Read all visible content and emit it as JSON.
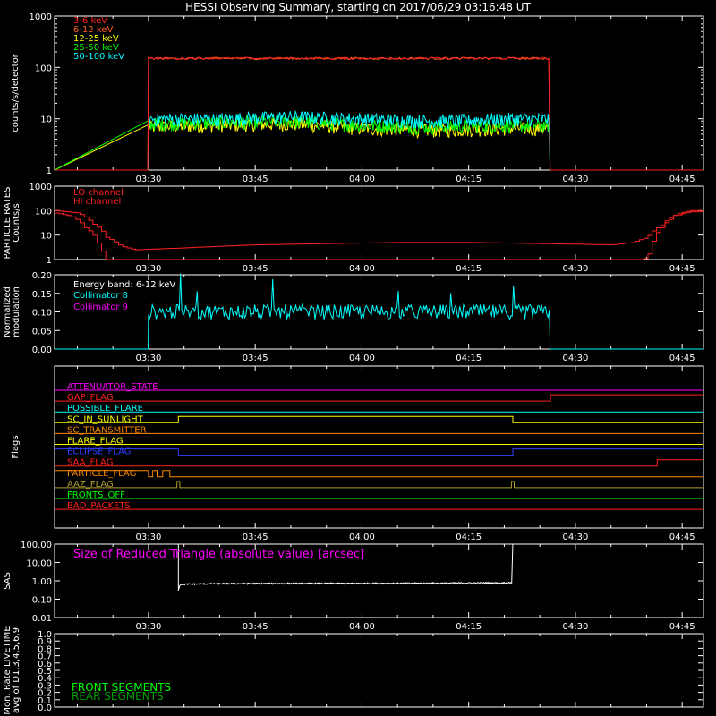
{
  "title": "HESSI Observing Summary, starting on 2017/06/29 03:16:48 UT",
  "time_axis": {
    "start_min": 16.8,
    "end_min": 108,
    "tick_min": [
      30,
      45,
      60,
      75,
      90,
      105
    ],
    "tick_labels": [
      "03:30",
      "03:45",
      "04:00",
      "04:15",
      "04:30",
      "04:45"
    ]
  },
  "colors": {
    "red": "#ff2020",
    "orange": "#ff8800",
    "yellow": "#ffff00",
    "green": "#00ff00",
    "cyan": "#00ffff",
    "magenta": "#ff00ff",
    "blue": "#3040ff",
    "white": "#ffffff",
    "olive": "#b0a030",
    "darkgreen": "#00a000"
  },
  "chart_data": [
    {
      "type": "line",
      "name": "count-rates",
      "ylabel": "counts/s/detector",
      "yscale": "log",
      "ylim": [
        1,
        1000
      ],
      "y_ticks": [
        1,
        10,
        100,
        1000
      ],
      "y_tick_labels": [
        "1",
        "10",
        "100",
        "1000"
      ],
      "legend_position": "top-left",
      "series": [
        {
          "name": "3-6 keV",
          "color": "#ff2020",
          "x": [
            16.8,
            29.9,
            30.0,
            86.4,
            86.5,
            108
          ],
          "y": [
            1,
            1,
            150,
            150,
            1,
            1
          ]
        },
        {
          "name": "6-12 keV",
          "color": "#ff6020",
          "x": [
            16.8,
            29.9,
            30.0,
            86.4,
            86.5,
            108
          ],
          "y": [
            1,
            1,
            150,
            150,
            1,
            1
          ]
        },
        {
          "name": "12-25 keV",
          "color": "#ffff00",
          "x": [
            30,
            40,
            50,
            60,
            70,
            80,
            86.4
          ],
          "y": [
            7,
            7.5,
            8,
            6.5,
            6,
            6.5,
            6.5
          ]
        },
        {
          "name": "25-50 keV",
          "color": "#00ff00",
          "x": [
            30,
            40,
            50,
            60,
            70,
            80,
            86.4
          ],
          "y": [
            8,
            8.5,
            9,
            7.5,
            7,
            7.5,
            7.5
          ]
        },
        {
          "name": "50-100 keV",
          "color": "#00ffff",
          "x": [
            16.8,
            29.9,
            30.0,
            40,
            50,
            60,
            70,
            80,
            86.4,
            86.5,
            108
          ],
          "y": [
            1,
            1,
            10,
            10,
            11,
            10,
            9,
            10,
            10,
            1,
            1
          ]
        }
      ]
    },
    {
      "type": "line",
      "name": "particle-rates",
      "ylabel": "PARTICLE RATES Counts/s",
      "yscale": "log",
      "ylim": [
        1,
        1000
      ],
      "y_ticks": [
        1,
        10,
        100,
        1000
      ],
      "y_tick_labels": [
        "1",
        "10",
        "100",
        "1000"
      ],
      "legend_position": "top-left",
      "series": [
        {
          "name": "LO channel",
          "color": "#ff2020",
          "x": [
            16.8,
            20,
            22,
            24,
            26,
            28,
            35,
            45,
            55,
            65,
            75,
            85,
            95,
            98,
            100,
            102,
            104,
            106,
            108
          ],
          "y": [
            100,
            80,
            30,
            8,
            3.5,
            2.5,
            3,
            4,
            4.5,
            5,
            5,
            4.5,
            4,
            5,
            8,
            25,
            70,
            100,
            100
          ]
        },
        {
          "name": "HI channel",
          "color": "#ff2020",
          "x": [
            16.8,
            19,
            21,
            23,
            24,
            99.5,
            100.5,
            102,
            104,
            106,
            108
          ],
          "y": [
            80,
            60,
            20,
            3,
            1,
            1,
            2,
            20,
            60,
            90,
            90
          ]
        }
      ]
    },
    {
      "type": "line",
      "name": "modulation",
      "ylabel": "Normalized modulation",
      "ylim": [
        0,
        0.2
      ],
      "y_ticks": [
        0,
        0.05,
        0.1,
        0.15,
        0.2
      ],
      "y_tick_labels": [
        "0.00",
        "0.05",
        "0.10",
        "0.15",
        "0.20"
      ],
      "annotation": "Energy band: 6-12 keV",
      "legend_position": "top-left",
      "series": [
        {
          "name": "Collimator 8",
          "color": "#00ffff",
          "x": [
            16.8,
            29.9,
            30.0,
            86.4,
            86.5,
            108
          ],
          "y": [
            0,
            0,
            0.1,
            0.1,
            0,
            0
          ]
        },
        {
          "name": "Collimator 9",
          "color": "#ff00ff",
          "x": [],
          "y": []
        }
      ]
    },
    {
      "type": "line",
      "name": "flags",
      "ylabel": "Flags",
      "flags": [
        {
          "name": "ATTENUATOR_STATE",
          "color": "#ff00ff",
          "x": [
            16.8,
            108
          ],
          "y": [
            0,
            0
          ]
        },
        {
          "name": "GAP_FLAG",
          "color": "#ff2020",
          "x": [
            16.8,
            86.5,
            86.5,
            108
          ],
          "y": [
            0,
            0,
            1,
            1
          ]
        },
        {
          "name": "POSSIBLE_FLARE",
          "color": "#00ffff",
          "x": [
            16.8,
            108
          ],
          "y": [
            0,
            0
          ]
        },
        {
          "name": "SC_IN_SUNLIGHT",
          "color": "#ffff00",
          "x": [
            16.8,
            34.2,
            34.2,
            81.2,
            81.2,
            108
          ],
          "y": [
            0,
            0,
            1,
            1,
            0,
            0
          ]
        },
        {
          "name": "SC_TRANSMITTER",
          "color": "#ff8800",
          "x": [
            16.8,
            108
          ],
          "y": [
            0,
            0
          ]
        },
        {
          "name": "FLARE_FLAG",
          "color": "#ffff00",
          "x": [
            16.8,
            108
          ],
          "y": [
            0,
            0
          ]
        },
        {
          "name": "ECLIPSE_FLAG",
          "color": "#3040ff",
          "x": [
            16.8,
            34.2,
            34.2,
            81.2,
            81.2,
            108
          ],
          "y": [
            1,
            1,
            0,
            0,
            1,
            1
          ]
        },
        {
          "name": "SAA_FLAG",
          "color": "#ff2020",
          "x": [
            16.8,
            101.5,
            101.5,
            108
          ],
          "y": [
            0,
            0,
            1,
            1
          ]
        },
        {
          "name": "PARTICLE_FLAG",
          "color": "#ff8800",
          "x": [
            16.8,
            30.0,
            30.0,
            30.6,
            30.6,
            31.2,
            31.2,
            32.0,
            32.0,
            33.0,
            33.0,
            108
          ],
          "y": [
            1,
            1,
            0,
            0,
            1,
            1,
            0,
            0,
            1,
            1,
            0,
            0
          ]
        },
        {
          "name": "AAZ_FLAG",
          "color": "#b0a030",
          "x": [
            16.8,
            34.0,
            34.0,
            34.4,
            34.4,
            81.0,
            81.0,
            81.4,
            81.4,
            108
          ],
          "y": [
            0,
            0,
            1,
            1,
            0,
            0,
            1,
            1,
            0,
            0
          ]
        },
        {
          "name": "FRONTS_OFF",
          "color": "#00ff00",
          "x": [
            16.8,
            108
          ],
          "y": [
            0,
            0
          ]
        },
        {
          "name": "BAD_PACKETS",
          "color": "#ff2020",
          "x": [
            16.8,
            108
          ],
          "y": [
            0,
            0
          ]
        }
      ]
    },
    {
      "type": "line",
      "name": "sas",
      "ylabel": "SAS",
      "yscale": "log",
      "ylim": [
        0.01,
        100
      ],
      "y_ticks": [
        0.01,
        0.1,
        1,
        10,
        100
      ],
      "y_tick_labels": [
        "0.01",
        "0.10",
        "1.00",
        "10.00",
        "100.00"
      ],
      "annotation": "Size of Reduced Triangle (absolute value) [arcsec]",
      "series": [
        {
          "color": "#ffffff",
          "x": [
            34.2,
            34.2,
            34.6,
            40,
            50,
            60,
            70,
            80,
            81.2,
            81.2
          ],
          "y": [
            100,
            0.5,
            0.65,
            0.7,
            0.72,
            0.73,
            0.75,
            0.78,
            0.8,
            100
          ]
        }
      ]
    },
    {
      "type": "line",
      "name": "livetime",
      "ylabel": "Mon. Rate LIVETIME avg of D1,3,4,5,6,9",
      "ylim": [
        0,
        1
      ],
      "y_ticks": [
        0,
        0.1,
        0.2,
        0.3,
        0.4,
        0.5,
        0.6,
        0.7,
        0.8,
        0.9,
        1.0
      ],
      "y_tick_labels": [
        "0.0",
        "0.1",
        "0.2",
        "0.3",
        "0.4",
        "0.5",
        "0.6",
        "0.7",
        "0.8",
        "0.9",
        "1.0"
      ],
      "legend_position": "bottom-left",
      "series": [
        {
          "name": "FRONT SEGMENTS",
          "color": "#00ff00",
          "x": [],
          "y": []
        },
        {
          "name": "REAR SEGMENTS",
          "color": "#00a000",
          "x": [],
          "y": []
        }
      ]
    }
  ]
}
